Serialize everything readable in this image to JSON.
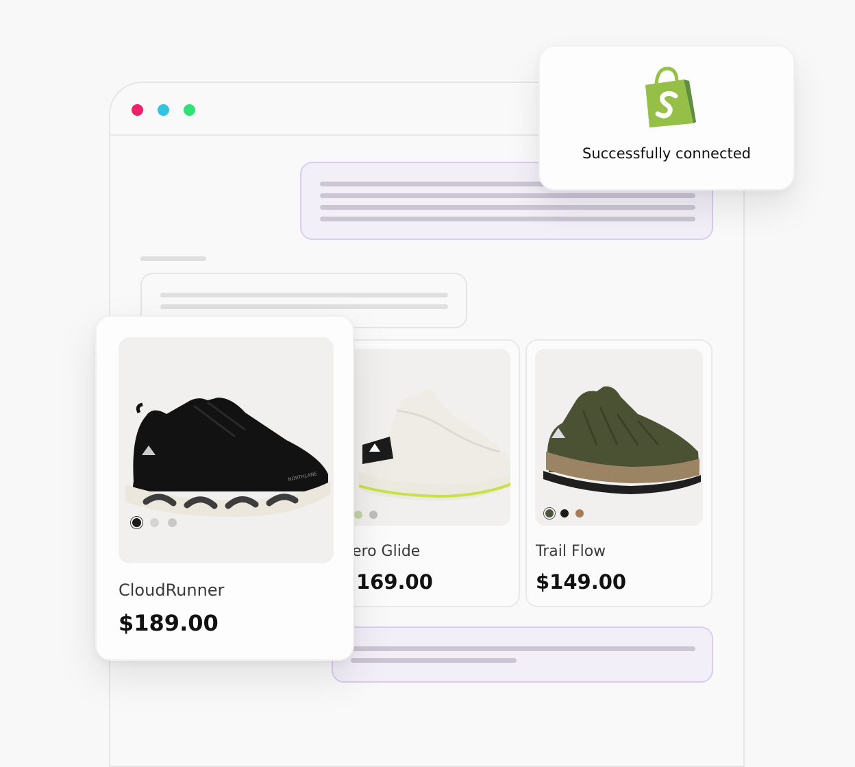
{
  "window": {
    "controls": [
      "close",
      "minimize",
      "maximize"
    ],
    "colors": {
      "close": "#ef1f6a",
      "minimize": "#34c3de",
      "maximize": "#2fe276"
    }
  },
  "toast": {
    "icon": "shopify-bag-icon",
    "brand_color": "#95bf47",
    "message": "Successfully connected"
  },
  "products": [
    {
      "name": "CloudRunner",
      "price": "$189.00",
      "colors": [
        "#1b1b1b",
        "#d4d4d4",
        "#c8c8c8"
      ],
      "selected": 0
    },
    {
      "name": "ero Glide",
      "price": "169.00",
      "colors": [
        "#e8e6dd",
        "#c6d3a6",
        "#bdbdbd"
      ]
    },
    {
      "name": "Trail Flow",
      "price": "$149.00",
      "colors": [
        "#4a5437",
        "#1b1b1b",
        "#a87d55"
      ],
      "selected": 0
    }
  ],
  "accent": "#d8cdf0"
}
